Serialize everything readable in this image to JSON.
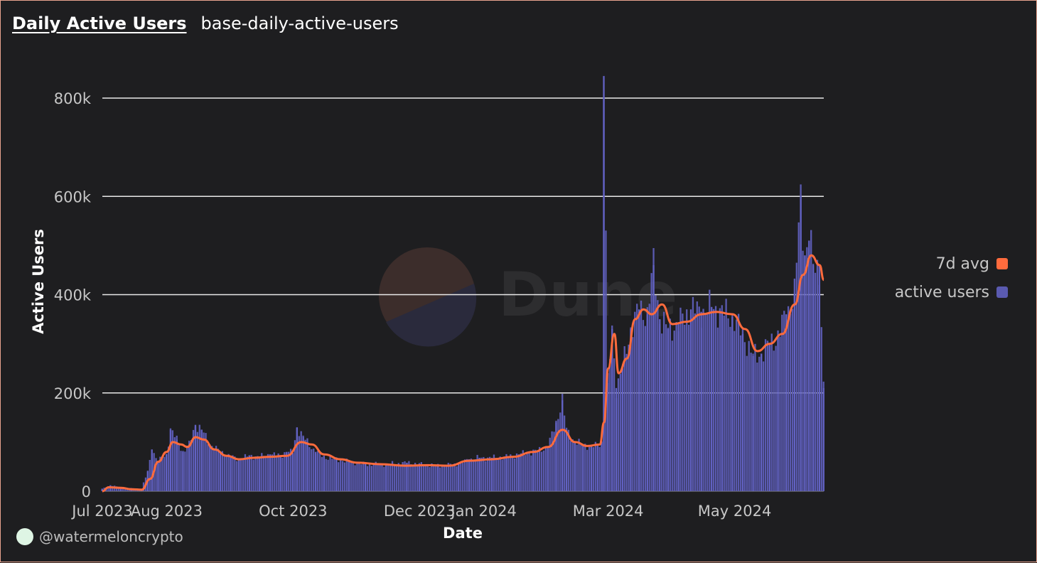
{
  "header": {
    "title": "Daily Active Users",
    "subtitle": "base-daily-active-users"
  },
  "watermark": {
    "text": "Dune"
  },
  "footer": {
    "handle": "@watermeloncrypto"
  },
  "colors": {
    "avg": "#ff6b3d",
    "bars": "#5a5ab0",
    "grid": "#e9e9e9",
    "axis_text": "#c7c7c7"
  },
  "chart_data": {
    "type": "bar",
    "xlabel": "Date",
    "ylabel": "Active Users",
    "ylim": [
      0,
      800000
    ],
    "yticks": [
      {
        "value": 0,
        "label": "0"
      },
      {
        "value": 200000,
        "label": "200k"
      },
      {
        "value": 400000,
        "label": "400k"
      },
      {
        "value": 600000,
        "label": "600k"
      },
      {
        "value": 800000,
        "label": "800k"
      }
    ],
    "xticks": [
      {
        "date": "2023-07-01",
        "label": "Jul 2023"
      },
      {
        "date": "2023-08-01",
        "label": "Aug 2023"
      },
      {
        "date": "2023-10-01",
        "label": "Oct 2023"
      },
      {
        "date": "2023-12-01",
        "label": "Dec 2023"
      },
      {
        "date": "2024-01-01",
        "label": "Jan 2024"
      },
      {
        "date": "2024-03-01",
        "label": "Mar 2024"
      },
      {
        "date": "2024-05-01",
        "label": "May 2024"
      }
    ],
    "legend": {
      "position": "right",
      "items": [
        {
          "label": "7d avg",
          "color": "#ff6b3d"
        },
        {
          "label": "active users",
          "color": "#5a5ab0"
        }
      ]
    },
    "series": [
      {
        "name": "active users",
        "type": "bar",
        "points": [
          [
            "2023-07-01",
            5000
          ],
          [
            "2023-07-05",
            12000
          ],
          [
            "2023-07-10",
            8000
          ],
          [
            "2023-07-15",
            6000
          ],
          [
            "2023-07-20",
            5000
          ],
          [
            "2023-07-23",
            40000
          ],
          [
            "2023-07-25",
            85000
          ],
          [
            "2023-07-28",
            60000
          ],
          [
            "2023-08-01",
            75000
          ],
          [
            "2023-08-03",
            125000
          ],
          [
            "2023-08-06",
            105000
          ],
          [
            "2023-08-09",
            80000
          ],
          [
            "2023-08-12",
            95000
          ],
          [
            "2023-08-15",
            135000
          ],
          [
            "2023-08-18",
            125000
          ],
          [
            "2023-08-22",
            95000
          ],
          [
            "2023-08-27",
            80000
          ],
          [
            "2023-09-01",
            70000
          ],
          [
            "2023-09-05",
            65000
          ],
          [
            "2023-09-10",
            72000
          ],
          [
            "2023-09-15",
            70000
          ],
          [
            "2023-09-20",
            75000
          ],
          [
            "2023-09-25",
            72000
          ],
          [
            "2023-09-28",
            80000
          ],
          [
            "2023-10-01",
            78000
          ],
          [
            "2023-10-03",
            130000
          ],
          [
            "2023-10-06",
            110000
          ],
          [
            "2023-10-08",
            100000
          ],
          [
            "2023-10-12",
            80000
          ],
          [
            "2023-10-16",
            70000
          ],
          [
            "2023-10-22",
            65000
          ],
          [
            "2023-10-28",
            60000
          ],
          [
            "2023-11-05",
            55000
          ],
          [
            "2023-11-15",
            55000
          ],
          [
            "2023-11-25",
            58000
          ],
          [
            "2023-12-01",
            55000
          ],
          [
            "2023-12-10",
            52000
          ],
          [
            "2023-12-20",
            55000
          ],
          [
            "2023-12-25",
            65000
          ],
          [
            "2023-12-30",
            68000
          ],
          [
            "2024-01-05",
            68000
          ],
          [
            "2024-01-12",
            70000
          ],
          [
            "2024-01-18",
            75000
          ],
          [
            "2024-01-25",
            80000
          ],
          [
            "2024-02-01",
            90000
          ],
          [
            "2024-02-05",
            140000
          ],
          [
            "2024-02-08",
            185000
          ],
          [
            "2024-02-10",
            125000
          ],
          [
            "2024-02-14",
            100000
          ],
          [
            "2024-02-18",
            95000
          ],
          [
            "2024-02-22",
            90000
          ],
          [
            "2024-02-25",
            95000
          ],
          [
            "2024-02-27",
            100000
          ],
          [
            "2024-02-28",
            845000
          ],
          [
            "2024-03-01",
            220000
          ],
          [
            "2024-03-03",
            330000
          ],
          [
            "2024-03-05",
            210000
          ],
          [
            "2024-03-08",
            250000
          ],
          [
            "2024-03-12",
            330000
          ],
          [
            "2024-03-16",
            370000
          ],
          [
            "2024-03-20",
            360000
          ],
          [
            "2024-03-23",
            460000
          ],
          [
            "2024-03-26",
            350000
          ],
          [
            "2024-03-30",
            330000
          ],
          [
            "2024-04-04",
            340000
          ],
          [
            "2024-04-10",
            370000
          ],
          [
            "2024-04-15",
            365000
          ],
          [
            "2024-04-20",
            375000
          ],
          [
            "2024-04-25",
            365000
          ],
          [
            "2024-04-30",
            355000
          ],
          [
            "2024-05-05",
            320000
          ],
          [
            "2024-05-10",
            275000
          ],
          [
            "2024-05-14",
            280000
          ],
          [
            "2024-05-18",
            300000
          ],
          [
            "2024-05-22",
            315000
          ],
          [
            "2024-05-26",
            360000
          ],
          [
            "2024-05-30",
            400000
          ],
          [
            "2024-06-02",
            600000
          ],
          [
            "2024-06-04",
            480000
          ],
          [
            "2024-06-06",
            510000
          ],
          [
            "2024-06-08",
            460000
          ],
          [
            "2024-06-11",
            460000
          ],
          [
            "2024-06-13",
            210000
          ]
        ]
      },
      {
        "name": "7d avg",
        "type": "line",
        "points": [
          [
            "2023-07-01",
            0
          ],
          [
            "2023-07-04",
            8000
          ],
          [
            "2023-07-10",
            7000
          ],
          [
            "2023-07-15",
            4000
          ],
          [
            "2023-07-20",
            3000
          ],
          [
            "2023-07-24",
            25000
          ],
          [
            "2023-07-28",
            60000
          ],
          [
            "2023-08-01",
            80000
          ],
          [
            "2023-08-04",
            100000
          ],
          [
            "2023-08-08",
            95000
          ],
          [
            "2023-08-11",
            90000
          ],
          [
            "2023-08-15",
            110000
          ],
          [
            "2023-08-19",
            105000
          ],
          [
            "2023-08-24",
            85000
          ],
          [
            "2023-08-30",
            72000
          ],
          [
            "2023-09-05",
            65000
          ],
          [
            "2023-09-12",
            68000
          ],
          [
            "2023-09-20",
            70000
          ],
          [
            "2023-09-28",
            72000
          ],
          [
            "2023-10-05",
            100000
          ],
          [
            "2023-10-10",
            95000
          ],
          [
            "2023-10-16",
            75000
          ],
          [
            "2023-10-24",
            65000
          ],
          [
            "2023-11-01",
            58000
          ],
          [
            "2023-11-12",
            55000
          ],
          [
            "2023-11-24",
            52000
          ],
          [
            "2023-12-05",
            53000
          ],
          [
            "2023-12-15",
            52000
          ],
          [
            "2023-12-25",
            62000
          ],
          [
            "2024-01-05",
            65000
          ],
          [
            "2024-01-15",
            70000
          ],
          [
            "2024-01-25",
            80000
          ],
          [
            "2024-02-01",
            90000
          ],
          [
            "2024-02-08",
            125000
          ],
          [
            "2024-02-14",
            100000
          ],
          [
            "2024-02-20",
            92000
          ],
          [
            "2024-02-26",
            95000
          ],
          [
            "2024-02-28",
            140000
          ],
          [
            "2024-03-01",
            250000
          ],
          [
            "2024-03-04",
            320000
          ],
          [
            "2024-03-06",
            240000
          ],
          [
            "2024-03-10",
            270000
          ],
          [
            "2024-03-14",
            350000
          ],
          [
            "2024-03-18",
            370000
          ],
          [
            "2024-03-22",
            360000
          ],
          [
            "2024-03-27",
            380000
          ],
          [
            "2024-04-01",
            340000
          ],
          [
            "2024-04-08",
            345000
          ],
          [
            "2024-04-15",
            360000
          ],
          [
            "2024-04-22",
            365000
          ],
          [
            "2024-04-30",
            360000
          ],
          [
            "2024-05-06",
            330000
          ],
          [
            "2024-05-12",
            285000
          ],
          [
            "2024-05-18",
            300000
          ],
          [
            "2024-05-24",
            320000
          ],
          [
            "2024-05-30",
            380000
          ],
          [
            "2024-06-03",
            440000
          ],
          [
            "2024-06-07",
            480000
          ],
          [
            "2024-06-11",
            460000
          ],
          [
            "2024-06-13",
            430000
          ]
        ]
      }
    ]
  }
}
